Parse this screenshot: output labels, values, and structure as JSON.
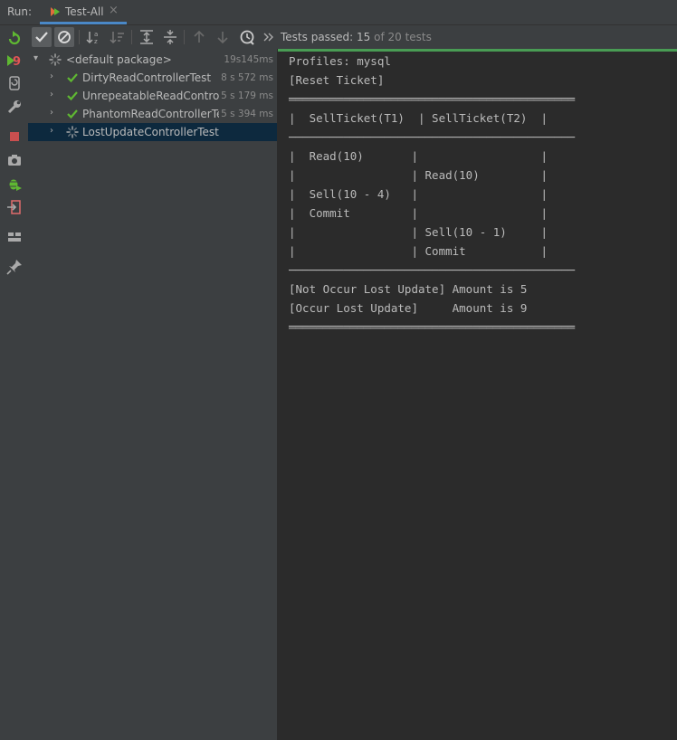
{
  "run_label": "Run:",
  "tab": {
    "label": "Test-All",
    "close": "×"
  },
  "status": {
    "prefix": "Tests passed: ",
    "passed": "15",
    "suffix": " of 20 tests"
  },
  "tree": [
    {
      "label": "<default package>",
      "time": "19s145ms",
      "status": "running",
      "indent": 0,
      "expanded": true
    },
    {
      "label": "DirtyReadControllerTest",
      "time": "8 s 572 ms",
      "status": "passed",
      "indent": 1
    },
    {
      "label": "UnrepeatableReadControllerTest",
      "time": "5 s 179 ms",
      "status": "passed",
      "indent": 1
    },
    {
      "label": "PhantomReadControllerTest",
      "time": "5 s 394 ms",
      "status": "passed",
      "indent": 1
    },
    {
      "label": "LostUpdateControllerTest",
      "time": "",
      "status": "running",
      "indent": 1,
      "selected": true
    }
  ],
  "console": {
    "lines": [
      "Profiles: mysql",
      "[Reset Ticket]",
      "══════════════════════════════════════════",
      "|  SellTicket(T1)  | SellTicket(T2)  |",
      "──────────────────────────────────────────",
      "|  Read(10)       |                  |",
      "|                 | Read(10)         |",
      "|  Sell(10 - 4)   |                  |",
      "|  Commit         |                  |",
      "|                 | Sell(10 - 1)     |",
      "|                 | Commit           |",
      "──────────────────────────────────────────",
      "[Not Occur Lost Update] Amount is 5",
      "[Occur Lost Update]     Amount is 9",
      "══════════════════════════════════════════"
    ]
  },
  "colors": {
    "accent_green": "#499c54",
    "pass_green": "#5fb832",
    "selection": "#0d293e",
    "tab_underline": "#4a88c7"
  },
  "icons": {
    "rerun": "rerun-icon",
    "rerun_failed": "rerun-failed-icon",
    "stop": "stop-icon",
    "settings": "wrench-icon"
  }
}
